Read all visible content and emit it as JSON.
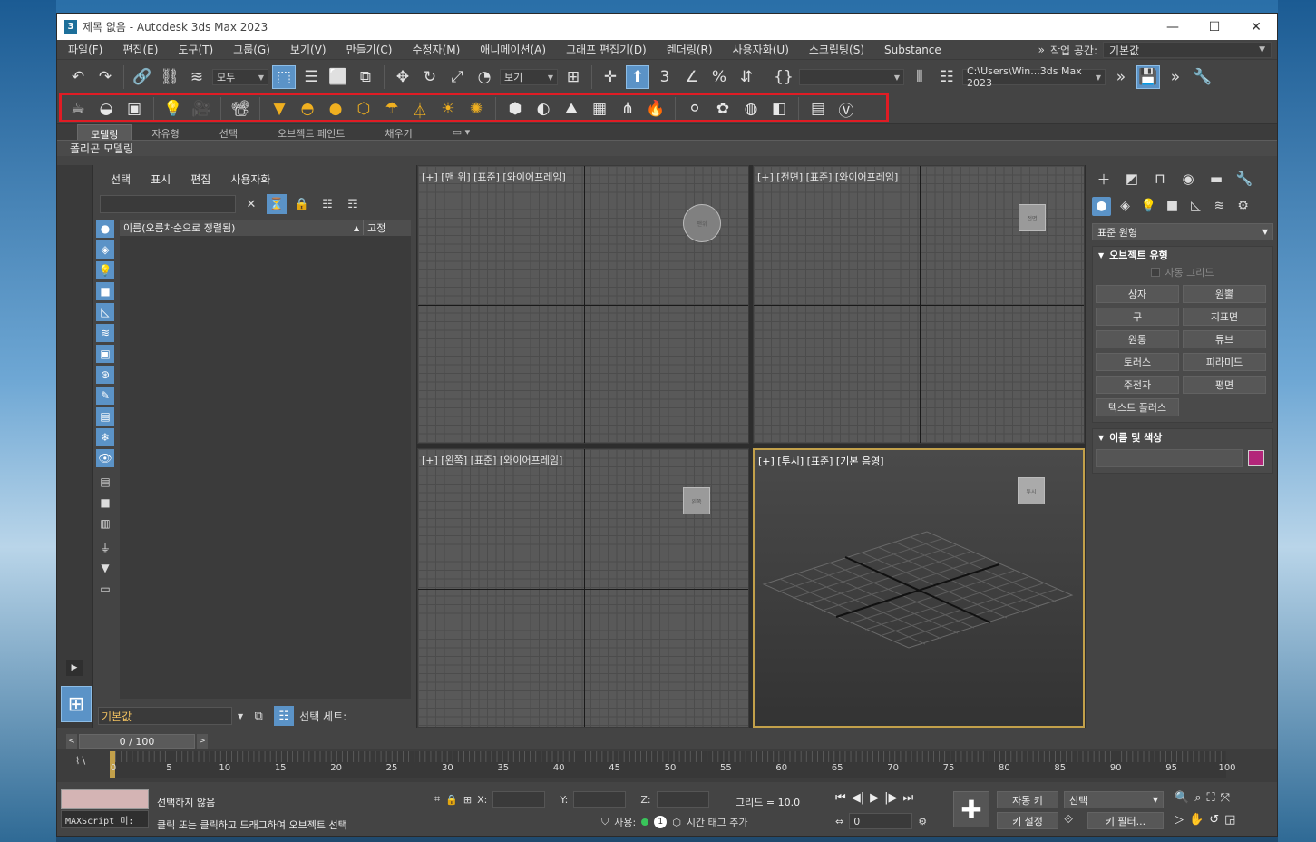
{
  "window": {
    "title": "제목 없음 - Autodesk 3ds Max 2023",
    "app_icon": "3"
  },
  "menu": {
    "items": [
      "파일(F)",
      "편집(E)",
      "도구(T)",
      "그룹(G)",
      "보기(V)",
      "만들기(C)",
      "수정자(M)",
      "애니메이션(A)",
      "그래프 편집기(D)",
      "렌더링(R)",
      "사용자화(U)",
      "스크립팅(S)",
      "Substance"
    ],
    "workspace_label": "작업 공간:",
    "workspace_value": "기본값",
    "more": "»"
  },
  "toolbar": {
    "selection_filter": "모두",
    "ref_coord": "보기",
    "named_sel": "",
    "project_path": "C:\\Users\\Win...3ds Max 2023"
  },
  "ribbon": {
    "tabs": [
      "모델링",
      "자유형",
      "선택",
      "오브젝트 페인트",
      "채우기"
    ],
    "active_tab": "모델링",
    "sub_label": "폴리곤 모델링"
  },
  "scene_explorer": {
    "menu": [
      "선택",
      "표시",
      "편집",
      "사용자화"
    ],
    "col_name": "이름(오름차순으로 정렬됨)",
    "col_freeze": "고정",
    "layer": "기본값",
    "selection_set": "선택 세트:"
  },
  "viewports": {
    "top": "[+] [맨 위] [표준] [와이어프레임]",
    "front": "[+] [전면] [표준] [와이어프레임]",
    "left": "[+] [왼쪽] [표준] [와이어프레임]",
    "persp": "[+] [투시] [표준] [기본 음영]"
  },
  "command_panel": {
    "category": "표준 원형",
    "rollout_object_type": "오브젝트 유형",
    "autogrid": "자동 그리드",
    "buttons": [
      "상자",
      "원뿔",
      "구",
      "지표면",
      "원통",
      "튜브",
      "토러스",
      "피라미드",
      "주전자",
      "평면",
      "텍스트 플러스"
    ],
    "rollout_name_color": "이름 및 색상",
    "object_color": "#b3267a"
  },
  "timeline": {
    "slider": "0 / 100",
    "ticks": [
      "0",
      "5",
      "10",
      "15",
      "20",
      "25",
      "30",
      "35",
      "40",
      "45",
      "50",
      "55",
      "60",
      "65",
      "70",
      "75",
      "80",
      "85",
      "90",
      "95",
      "100"
    ]
  },
  "status": {
    "maxscript": "MAXScript 미:",
    "line1": "선택하지 않음",
    "line2": "클릭 또는 클릭하고 드래그하여 오브젝트 선택",
    "x_label": "X:",
    "y_label": "Y:",
    "z_label": "Z:",
    "grid": "그리드 = 10.0",
    "use_label": "사용:",
    "add_time_tag": "시간 태그 추가",
    "frame": "0",
    "auto_key": "자동 키",
    "set_key": "키 설정",
    "selected": "선택",
    "key_filters": "키 필터..."
  }
}
